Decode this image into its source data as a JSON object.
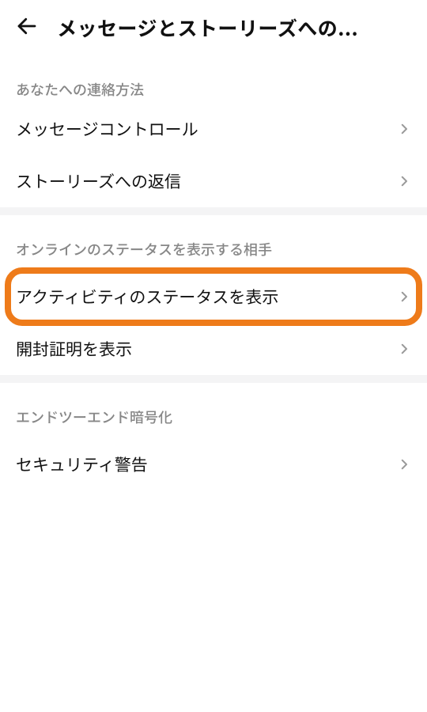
{
  "header": {
    "title": "メッセージとストーリーズへの..."
  },
  "sections": {
    "contact": {
      "header": "あなたへの連絡方法",
      "message_control": "メッセージコントロール",
      "story_replies": "ストーリーズへの返信"
    },
    "online_status": {
      "header": "オンラインのステータスを表示する相手",
      "activity_status": "アクティビティのステータスを表示",
      "read_receipts": "開封証明を表示"
    },
    "e2ee": {
      "header": "エンドツーエンド暗号化",
      "security_alerts": "セキュリティ警告"
    }
  },
  "highlight_color": "#ee7b1a"
}
